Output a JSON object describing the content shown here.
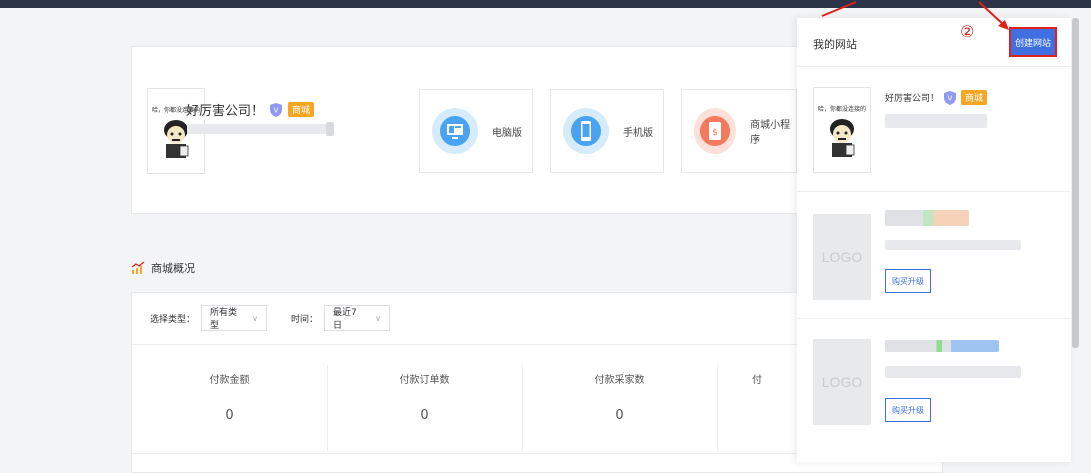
{
  "profile": {
    "company_name": "好厉害公司！",
    "badge": "商城",
    "avatar_caption": "哈，你都没连接的"
  },
  "versions": [
    {
      "label": "电脑版",
      "icon": "monitor-icon",
      "color": "#4aa3f0",
      "bg": "#d6ecfb"
    },
    {
      "label": "手机版",
      "icon": "phone-icon",
      "color": "#4aa3f0",
      "bg": "#d6ecfb"
    },
    {
      "label": "商城小程序",
      "icon": "mini-program-icon",
      "color": "#f47a5e",
      "bg": "#fde0d9"
    }
  ],
  "overview": {
    "title": "商城概况",
    "type_label": "选择类型：",
    "type_value": "所有类型",
    "time_label": "时间：",
    "time_value": "最近7日",
    "stats": [
      {
        "label": "付款金额",
        "value": "0"
      },
      {
        "label": "付款订单数",
        "value": "0"
      },
      {
        "label": "付款采家数",
        "value": "0"
      },
      {
        "label": "付",
        "value": ""
      }
    ]
  },
  "drawer": {
    "title": "我的网站",
    "create_label": "创建网站",
    "step_mark": "②",
    "site_name": "好厉害公司！",
    "site_badge": "商城",
    "logo_text": "LOGO",
    "buy_label": "购买升级"
  },
  "colors": {
    "accent": "#3f6fe0",
    "highlight_red": "#e0201d",
    "badge_orange": "#f5a623",
    "topbar": "#2b3447"
  }
}
